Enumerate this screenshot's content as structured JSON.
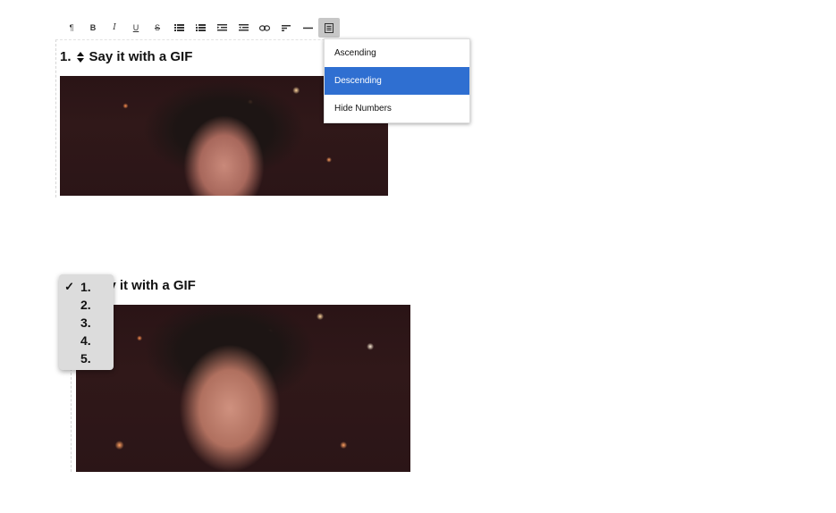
{
  "toolbar": {
    "items": [
      {
        "label": "¶",
        "icon": "paragraph-icon"
      },
      {
        "label": "B",
        "icon": "bold-icon"
      },
      {
        "label": "I",
        "icon": "italic-icon"
      },
      {
        "label": "U",
        "icon": "underline-icon"
      },
      {
        "label": "S",
        "icon": "strikethrough-icon"
      },
      {
        "label": "",
        "icon": "bullet-list-icon"
      },
      {
        "label": "",
        "icon": "numbered-list-icon"
      },
      {
        "label": "",
        "icon": "indent-icon"
      },
      {
        "label": "",
        "icon": "outdent-icon"
      },
      {
        "label": "",
        "icon": "link-icon"
      },
      {
        "label": "",
        "icon": "align-left-icon"
      },
      {
        "label": "",
        "icon": "horizontal-rule-icon"
      },
      {
        "label": "",
        "icon": "order-list-icon"
      }
    ],
    "active_index": 12
  },
  "top_block": {
    "number": "1.",
    "title": "Say it with a GIF"
  },
  "order_menu": {
    "items": [
      "Ascending",
      "Descending",
      "Hide Numbers"
    ],
    "selected": "Descending",
    "accent": "#2f6fd1"
  },
  "bottom_block": {
    "title": "ay it with a GIF"
  },
  "number_picker": {
    "options": [
      "1.",
      "2.",
      "3.",
      "4.",
      "5."
    ],
    "checked": "1.",
    "check_mark": "✓"
  }
}
